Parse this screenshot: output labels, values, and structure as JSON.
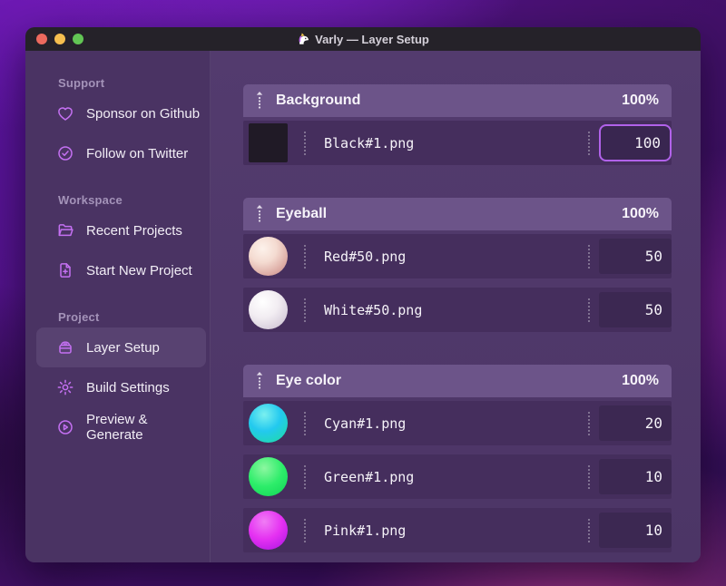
{
  "window": {
    "title": "Varly — Layer Setup",
    "traffic_lights": [
      {
        "name": "close-button",
        "color": "#ec6a5e"
      },
      {
        "name": "minimize-button",
        "color": "#f5bf4f"
      },
      {
        "name": "zoom-button",
        "color": "#62c554"
      }
    ]
  },
  "sidebar": {
    "sections": [
      {
        "label": "Support",
        "items": [
          {
            "label": "Sponsor on Github",
            "icon": "heart-icon",
            "active": false
          },
          {
            "label": "Follow on Twitter",
            "icon": "verified-check-icon",
            "active": false
          }
        ]
      },
      {
        "label": "Workspace",
        "items": [
          {
            "label": "Recent Projects",
            "icon": "folder-open-icon",
            "active": false
          },
          {
            "label": "Start New Project",
            "icon": "file-plus-icon",
            "active": false
          }
        ]
      },
      {
        "label": "Project",
        "items": [
          {
            "label": "Layer Setup",
            "icon": "layers-icon",
            "active": true
          },
          {
            "label": "Build Settings",
            "icon": "gear-icon",
            "active": false
          },
          {
            "label": "Preview & Generate",
            "icon": "play-circle-icon",
            "active": false
          }
        ]
      }
    ]
  },
  "main": {
    "groups": [
      {
        "name": "Background",
        "percent": "100%",
        "layers": [
          {
            "file": "Black#1.png",
            "value": "100",
            "thumb": "black-square",
            "focused": true
          }
        ]
      },
      {
        "name": "Eyeball",
        "percent": "100%",
        "layers": [
          {
            "file": "Red#50.png",
            "value": "50",
            "thumb": "red-sphere",
            "focused": false
          },
          {
            "file": "White#50.png",
            "value": "50",
            "thumb": "white-sphere",
            "focused": false
          }
        ]
      },
      {
        "name": "Eye color",
        "percent": "100%",
        "layers": [
          {
            "file": "Cyan#1.png",
            "value": "20",
            "thumb": "cyan-sphere",
            "focused": false
          },
          {
            "file": "Green#1.png",
            "value": "10",
            "thumb": "green-sphere",
            "focused": false
          },
          {
            "file": "Pink#1.png",
            "value": "10",
            "thumb": "pink-sphere",
            "focused": false
          }
        ]
      }
    ]
  },
  "colors": {
    "accent_icon": "#c470f2",
    "focus_border": "#b162ea",
    "group_header": "#6c5489",
    "row": "#452e5d",
    "sidebar": "#4a3363",
    "thumbs": {
      "black-square": "#201a26",
      "red-sphere": "radial-gradient(circle at 36% 30%, #fdf2eb 0%, #f4dbd1 38%, #dcaba4 72%, #bb8382 100%)",
      "white-sphere": "radial-gradient(circle at 36% 30%, #ffffff 0%, #f2edf2 42%, #d9d0dd 75%, #b5aabf 100%)",
      "cyan-sphere": "radial-gradient(circle at 40% 28%, #7af0ef 0%, #23c9ef 45%, #1ede9c 100%)",
      "green-sphere": "radial-gradient(circle at 40% 28%, #8cf7a0 0%, #2ded6a 50%, #0fd455 100%)",
      "pink-sphere": "radial-gradient(circle at 40% 28%, #f07df5 0%, #e531f2 48%, #a613e0 100%)"
    }
  }
}
